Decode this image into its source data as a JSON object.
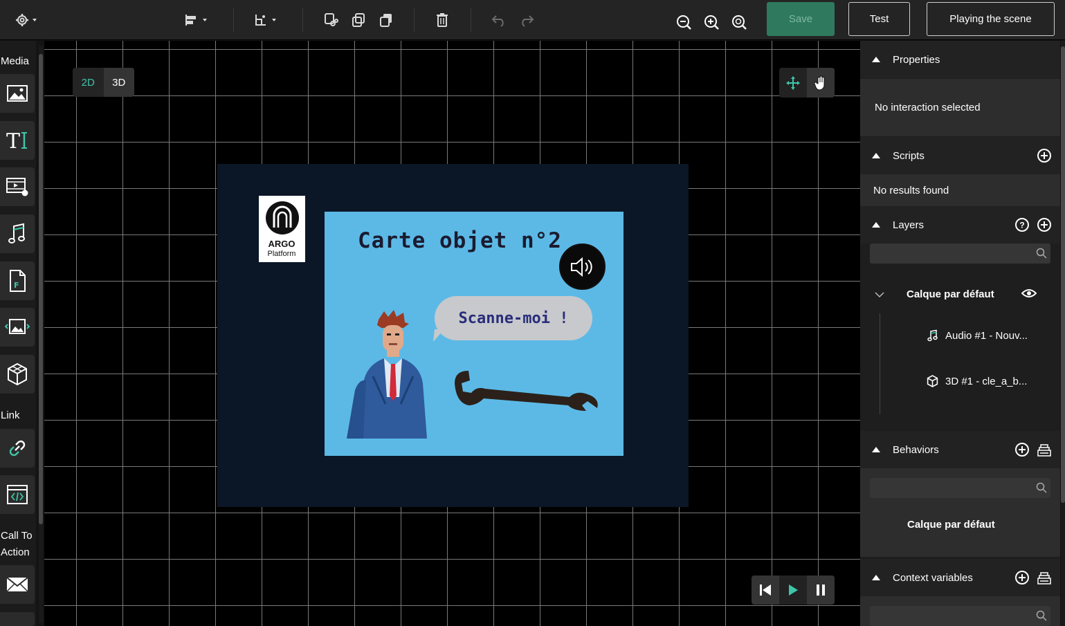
{
  "toolbar": {
    "settings_icon": "gear-icon",
    "align_icon": "align-icon",
    "transform_icon": "transform-icon",
    "cut_icon": "cut-icon",
    "copy_icon": "copy-icon",
    "paste_icon": "paste-icon",
    "delete_icon": "trash-icon",
    "undo_icon": "undo-icon",
    "redo_icon": "redo-icon",
    "zoom_out_icon": "zoom-out-icon",
    "zoom_in_icon": "zoom-in-icon",
    "zoom_fit_icon": "zoom-fit-icon",
    "save_label": "Save",
    "test_label": "Test",
    "play_scene_label": "Playing the scene"
  },
  "left_panel": {
    "media_label": "Media",
    "link_label": "Link",
    "cta_label_1": "Call To",
    "cta_label_2": "Action",
    "tools": [
      "image-icon",
      "text-icon",
      "video-icon",
      "audio-icon",
      "file-icon",
      "gallery-icon",
      "model-3d-icon",
      "link-icon",
      "embed-icon",
      "email-icon"
    ]
  },
  "canvas": {
    "mode_2d": "2D",
    "mode_3d": "3D",
    "move_tool_icon": "move-icon",
    "hand_tool_icon": "hand-icon",
    "logo_text_1": "ARGO",
    "logo_text_2": "Platform",
    "card_title": "Carte objet n°2",
    "bubble_text": "Scanne-moi !",
    "playback": [
      "skip-back-icon",
      "play-icon",
      "pause-icon"
    ]
  },
  "right_panel": {
    "properties": {
      "title": "Properties",
      "empty": "No interaction selected"
    },
    "scripts": {
      "title": "Scripts",
      "empty": "No results found"
    },
    "layers": {
      "title": "Layers",
      "default_layer": "Calque par défaut",
      "items": [
        {
          "icon": "audio-icon",
          "label": "Audio #1 - Nouv..."
        },
        {
          "icon": "model-3d-icon",
          "label": "3D #1 - cle_a_b..."
        }
      ]
    },
    "behaviors": {
      "title": "Behaviors",
      "layer": "Calque par défaut"
    },
    "context_variables": {
      "title": "Context variables"
    }
  },
  "colors": {
    "accent": "#2f7a5f",
    "canvas_bg": "#000000",
    "scene_bg": "#0b1626",
    "card_bg": "#5cb9e6",
    "active_mode": "#3ec6a8"
  }
}
